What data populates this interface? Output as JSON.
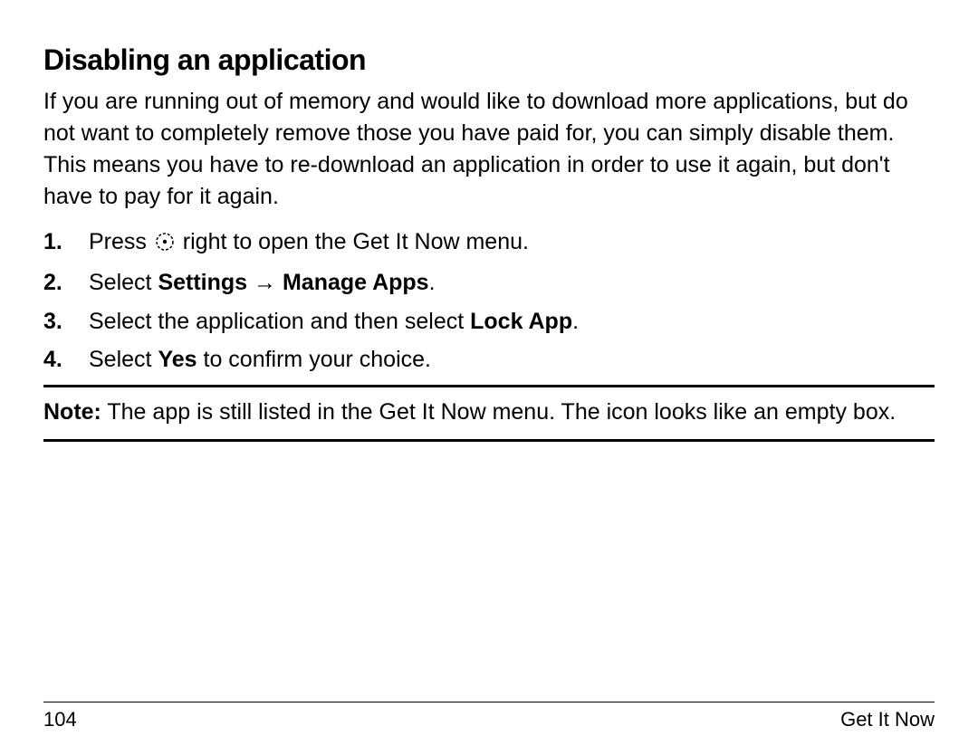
{
  "heading": "Disabling an application",
  "intro": "If you are running out of memory and would like to download more applications, but do not want to completely remove those you have paid for, you can simply disable them. This means you have to re-download an application in order to use it again, but don't have to pay for it again.",
  "steps": {
    "s1_pre": "Press ",
    "s1_post": " right to open the Get It Now menu.",
    "s2_pre": "Select ",
    "s2_b1": "Settings",
    "s2_arrow": " → ",
    "s2_b2": "Manage Apps",
    "s2_post": ".",
    "s3_pre": "Select the application and then select ",
    "s3_b": "Lock App",
    "s3_post": ".",
    "s4_pre": "Select ",
    "s4_b": "Yes",
    "s4_post": " to confirm your choice."
  },
  "note": {
    "label": "Note:",
    "text": " The app is still listed in the Get It Now menu. The icon looks like an empty box."
  },
  "footer": {
    "page": "104",
    "section": "Get It Now"
  }
}
